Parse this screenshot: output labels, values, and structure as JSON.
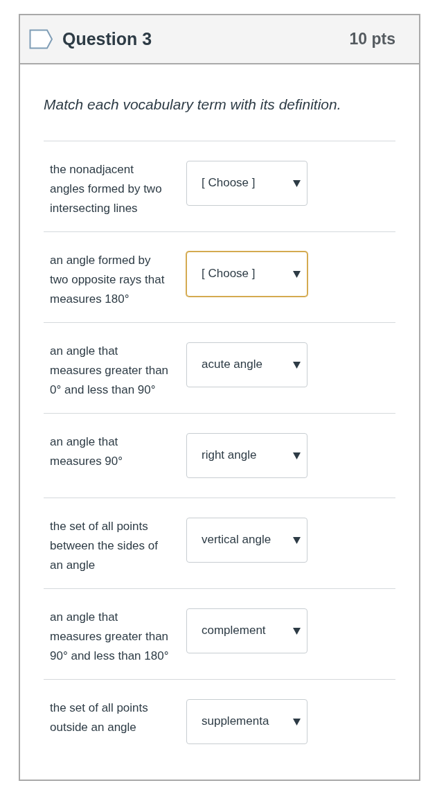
{
  "question": {
    "title": "Question 3",
    "points": "10 pts",
    "prompt": "Match each vocabulary term with its definition."
  },
  "matches": [
    {
      "definition": "the nonadjacent angles formed by two intersecting lines",
      "answer": "[ Choose ]",
      "focused": false
    },
    {
      "definition": "an angle formed by two opposite rays that measures 180°",
      "answer": "[ Choose ]",
      "focused": true
    },
    {
      "definition": "an angle that measures greater than 0° and less than 90°",
      "answer": "acute angle",
      "focused": false
    },
    {
      "definition": "an angle that measures 90°",
      "answer": "right angle",
      "focused": false
    },
    {
      "definition": "the set of all points between the sides of an angle",
      "answer": "vertical angle",
      "focused": false
    },
    {
      "definition": "an angle that measures greater than 90° and less than 180°",
      "answer": "complement",
      "focused": false
    },
    {
      "definition": "the set of all points outside an angle",
      "answer": "supplementa",
      "focused": false
    }
  ]
}
